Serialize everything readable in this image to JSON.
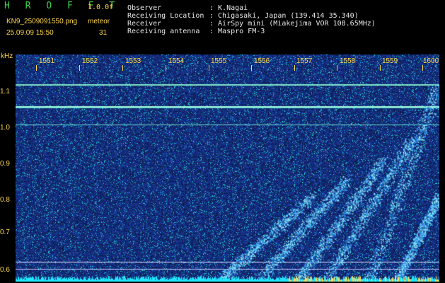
{
  "header": {
    "app_name": "H R O F F T",
    "version": "1.0.0f",
    "filename": "KN9_2509091550.png",
    "meteor_label": "meteor",
    "datetime": "25.09.09 15:50",
    "meteor_count": "31"
  },
  "info": {
    "labels": [
      "Observer",
      "Receiving Location",
      "Receiver",
      "Receiving antenna"
    ],
    "values": [
      ": K.Nagai",
      ": Chigasaki, Japan (139.414 35.340)",
      ": AirSpy mini (Miakejima VOR 108.65MHz)",
      ": Maspro FM-3"
    ]
  },
  "axes": {
    "y_unit": "kHz",
    "x_ticks": [
      "1551",
      "1552",
      "1553",
      "1554",
      "1555",
      "1556",
      "1557",
      "1558",
      "1559",
      "1600"
    ],
    "y_ticks": [
      "1.1",
      "1.0",
      "0.9",
      "0.8",
      "0.7",
      "0.6"
    ]
  },
  "colors": {
    "background": "#000000",
    "header_green": "#3cd64a",
    "tick_yellow": "#ffd84a",
    "noise_blue": "#1a2a9a",
    "signal_cyan": "#40e0ff"
  }
}
